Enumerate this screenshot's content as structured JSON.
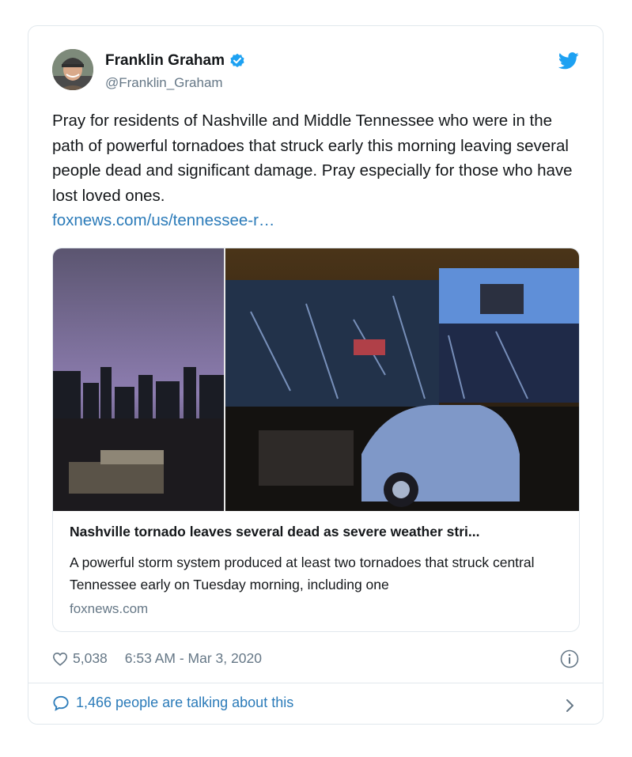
{
  "tweet": {
    "author_name": "Franklin Graham",
    "author_handle": "@Franklin_Graham",
    "text": "Pray for residents of Nashville and Middle Tennessee who were in the path of powerful tornadoes that struck early this morning leaving several people dead and significant damage. Pray especially for those who have lost loved ones.",
    "link_text": "foxnews.com/us/tennessee-r…",
    "likes": "5,038",
    "timestamp": "6:53 AM - Mar 3, 2020",
    "talking": "1,466 people are talking about this"
  },
  "link_card": {
    "title": "Nashville tornado leaves several dead as severe weather stri...",
    "description": "A powerful storm system produced at least two tornadoes that struck central Tennessee early on Tuesday morning, including one",
    "domain": "foxnews.com"
  },
  "colors": {
    "twitter_blue": "#1da1f2",
    "link": "#2b7bb9",
    "muted": "#657786",
    "border": "#e1e8ed"
  },
  "icons": [
    "verified-icon",
    "twitter-bird-icon",
    "heart-icon",
    "info-icon",
    "speech-bubble-icon",
    "chevron-right-icon"
  ]
}
